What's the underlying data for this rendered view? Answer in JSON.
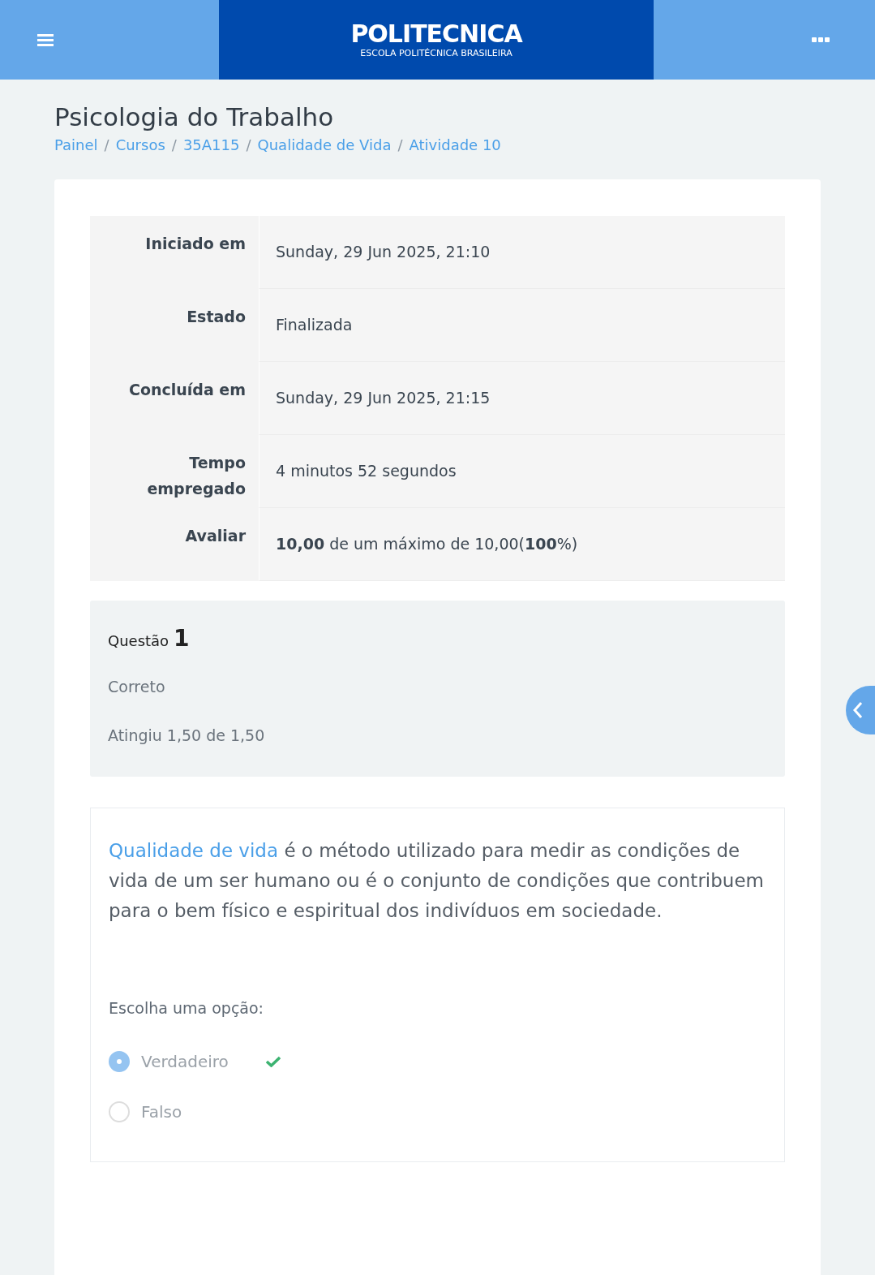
{
  "header": {
    "logo_title": "POLITECNICA",
    "logo_subtitle": "ESCOLA POLITÉCNICA BRASILEIRA"
  },
  "page_title": "Psicologia do Trabalho",
  "breadcrumb_separator": "/",
  "breadcrumb": [
    "Painel",
    "Cursos",
    "35A115",
    "Qualidade de Vida",
    "Atividade 10"
  ],
  "summary": [
    {
      "label": "Iniciado em",
      "value": "Sunday, 29 Jun 2025, 21:10"
    },
    {
      "label": "Estado",
      "value": "Finalizada"
    },
    {
      "label": "Concluída em",
      "value": "Sunday, 29 Jun 2025, 21:15"
    },
    {
      "label": "Tempo empregado",
      "value": "4 minutos 52 segundos"
    },
    {
      "label": "Avaliar",
      "value": "**10,00** de um máximo de 10,00(**100**%)"
    }
  ],
  "question": {
    "prefix": "Questão",
    "number": "1",
    "status": "Correto",
    "grade": "Atingiu 1,50 de 1,50",
    "link": "Qualidade de vida",
    "text": " é o método utilizado para medir as condições de vida de um ser humano ou é o conjunto de condições que contribuem para o bem físico e espiritual dos indivíduos em sociedade.",
    "prompt": "Escolha uma opção:",
    "options": [
      {
        "label": "Verdadeiro",
        "selected": true,
        "correct": true
      },
      {
        "label": "Falso",
        "selected": false,
        "correct": false
      }
    ]
  }
}
